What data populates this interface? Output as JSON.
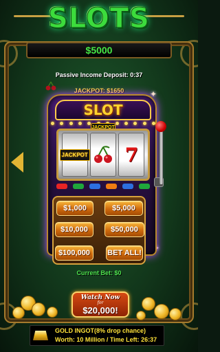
{
  "game": {
    "title": "SLOTS",
    "balance": "$5000",
    "passive_income": "Passive Income Deposit:  0:37",
    "jackpot": "JACKPOT: $1650",
    "machine": {
      "marquee": "SLOT",
      "top_badge": "JACKPOT",
      "reels": [
        "JACKPOT",
        "cherry",
        "7"
      ]
    },
    "bets": {
      "b1000": "$1,000",
      "b5000": "$5,000",
      "b10000": "$10,000",
      "b50000": "$50,000",
      "b100000": "$100,000",
      "bet_all": "BET ALL!"
    },
    "current_bet": "Current Bet: $0",
    "watch": {
      "line1": "Watch Now",
      "for": "for",
      "amount": "$20,000!"
    },
    "ingot": {
      "line1": "GOLD INGOT(8% drop chance)",
      "line2": "Worth: 10 Million / Time Left: 26:37"
    }
  },
  "colors": {
    "title_green": "#3cdc3c",
    "balance_green": "#45e845",
    "jackpot_yellow": "#ffe23a",
    "bet_orange": "#cf6a0d"
  },
  "icons": [
    "left-arrow-icon",
    "cherry-icon",
    "lever-icon",
    "gold-ingot-icon",
    "coin-icon"
  ]
}
